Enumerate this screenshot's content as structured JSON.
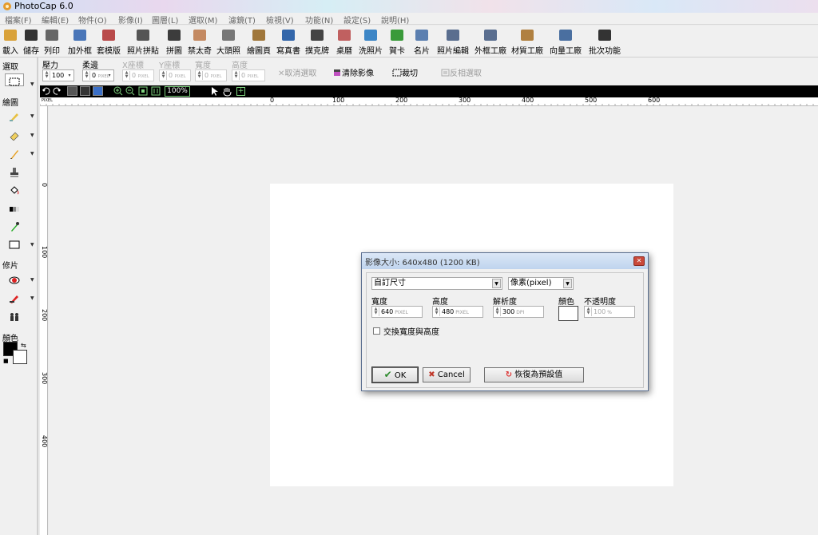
{
  "window": {
    "title": "PhotoCap 6.0"
  },
  "menu": [
    "檔案(F)",
    "編輯(E)",
    "物件(O)",
    "影像(I)",
    "圖層(L)",
    "選取(M)",
    "濾鏡(T)",
    "檢視(V)",
    "功能(N)",
    "設定(S)",
    "說明(H)"
  ],
  "toolbar": [
    {
      "label": "載入",
      "icon": "open-folder-icon"
    },
    {
      "label": "儲存",
      "icon": "save-icon"
    },
    {
      "label": "列印",
      "icon": "printer-icon"
    },
    {
      "label": "加外框",
      "icon": "frame-icon"
    },
    {
      "label": "套模版",
      "icon": "template-icon"
    },
    {
      "label": "照片拼貼",
      "icon": "collage-icon"
    },
    {
      "label": "拼圖",
      "icon": "puzzle-icon"
    },
    {
      "label": "禁太奇",
      "icon": "person-icon"
    },
    {
      "label": "大頭照",
      "icon": "id-photo-icon"
    },
    {
      "label": "繪圖頁",
      "icon": "drawing-page-icon"
    },
    {
      "label": "寫真書",
      "icon": "photobook-icon"
    },
    {
      "label": "撲克牌",
      "icon": "cards-icon"
    },
    {
      "label": "桌曆",
      "icon": "calendar-icon"
    },
    {
      "label": "洗照片",
      "icon": "print-photo-icon"
    },
    {
      "label": "賀卡",
      "icon": "greeting-card-icon"
    },
    {
      "label": "名片",
      "icon": "business-card-icon"
    },
    {
      "label": "照片編輯",
      "icon": "photo-edit-icon"
    },
    {
      "label": "外框工廠",
      "icon": "frame-factory-icon"
    },
    {
      "label": "材質工廠",
      "icon": "texture-factory-icon"
    },
    {
      "label": "向量工廠",
      "icon": "vector-factory-icon"
    },
    {
      "label": "批次功能",
      "icon": "batch-icon"
    }
  ],
  "options": {
    "section": "選取",
    "pressure": {
      "label": "壓力",
      "value": "100"
    },
    "softness": {
      "label": "柔邊",
      "value": "0",
      "unit": "PIXEL"
    },
    "x": {
      "label": "X座標",
      "value": "0",
      "unit": "PIXEL"
    },
    "y": {
      "label": "Y座標",
      "value": "0",
      "unit": "PIXEL"
    },
    "width": {
      "label": "寬度",
      "value": "0",
      "unit": "PIXEL"
    },
    "height": {
      "label": "高度",
      "value": "0",
      "unit": "PIXEL"
    },
    "cancel_selection": "取消選取",
    "clear_image": "清除影像",
    "crop": "裁切",
    "invert_selection": "反相選取"
  },
  "left_panel": {
    "draw_label": "繪圖",
    "retouch_label": "修片",
    "color_label": "顏色"
  },
  "view": {
    "zoom": "100%",
    "ruler_unit": "PIXEL"
  },
  "rulers": {
    "h": [
      "0",
      "100",
      "200",
      "300",
      "400",
      "500",
      "600"
    ],
    "v": [
      "0",
      "100",
      "200",
      "300",
      "400"
    ]
  },
  "dialog": {
    "title": "影像大小: 640x480 (1200 KB)",
    "preset": "自訂尺寸",
    "unit_select": "像素(pixel)",
    "width_label": "寬度",
    "width_value": "640",
    "width_unit": "PIXEL",
    "height_label": "高度",
    "height_value": "480",
    "height_unit": "PIXEL",
    "dpi_label": "解析度",
    "dpi_value": "300",
    "dpi_unit": "DPI",
    "color_label": "顏色",
    "opacity_label": "不透明度",
    "opacity_value": "100",
    "opacity_unit": "%",
    "swap_label": "交換寬度與高度",
    "ok": "OK",
    "cancel": "Cancel",
    "reset": "恢復為預設值"
  },
  "colors": {
    "accent_green": "#2e8b2e",
    "cancel_red": "#c0392b",
    "reset_red": "#d33",
    "foreground": "#000000",
    "background": "#ffffff"
  }
}
